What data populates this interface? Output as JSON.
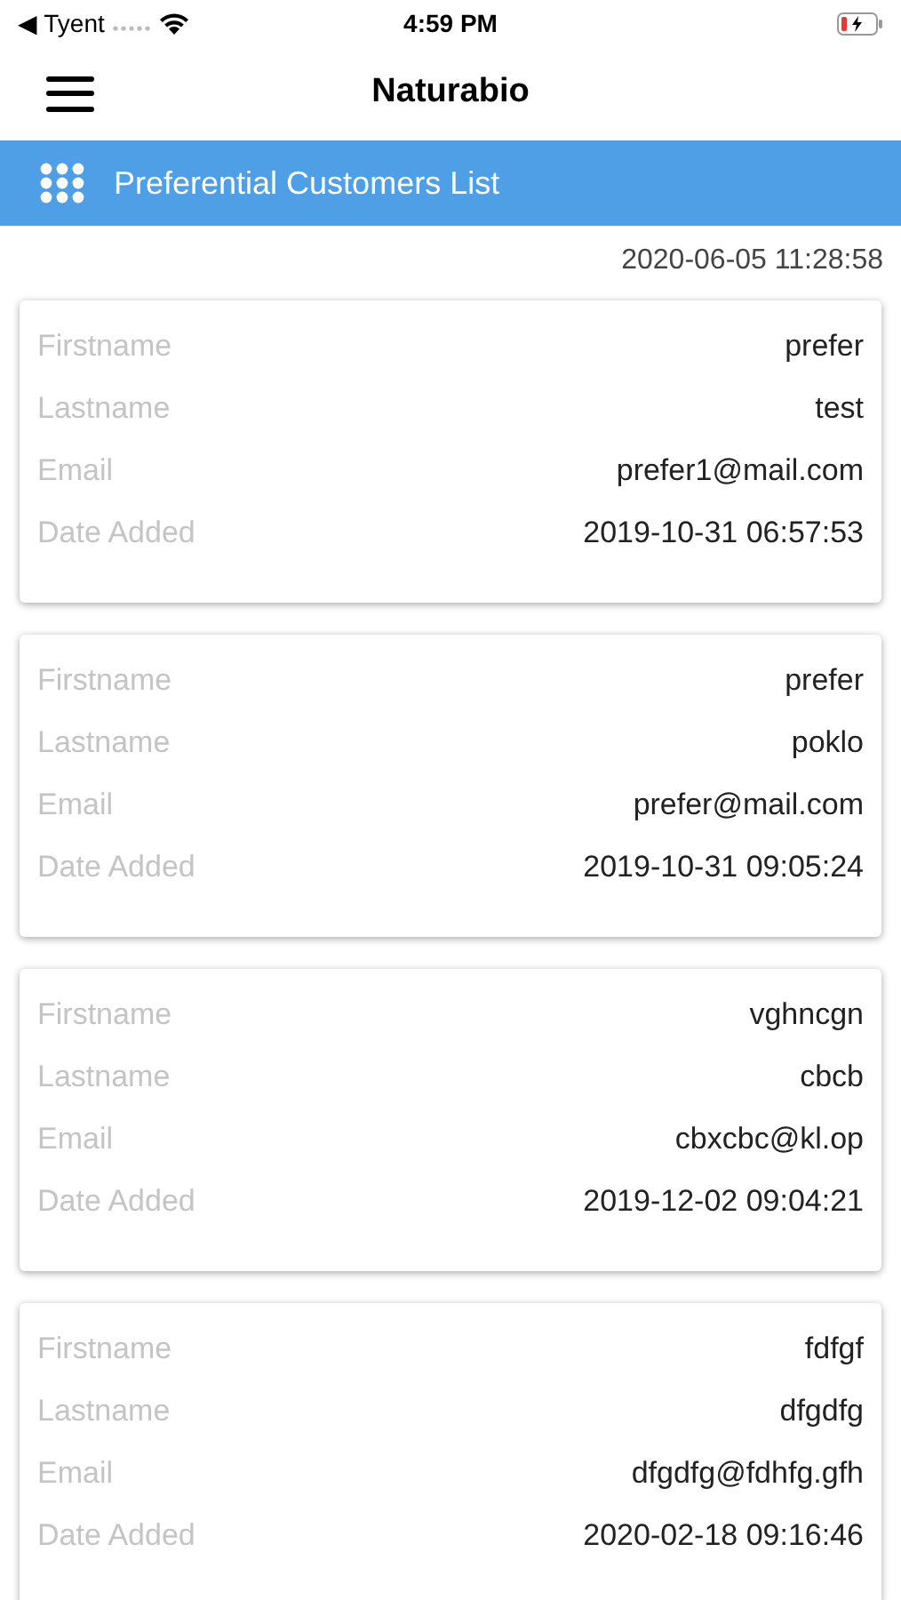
{
  "status_bar": {
    "back_label": "◀ Tyent",
    "time": "4:59 PM"
  },
  "nav": {
    "title": "Naturabio"
  },
  "section": {
    "title": "Preferential Customers List"
  },
  "timestamp": "2020-06-05 11:28:58",
  "customers": [
    {
      "fields": [
        {
          "label": "Firstname",
          "value": "prefer"
        },
        {
          "label": "Lastname",
          "value": "test"
        },
        {
          "label": "Email",
          "value": "prefer1@mail.com"
        },
        {
          "label": "Date Added",
          "value": "2019-10-31 06:57:53"
        }
      ]
    },
    {
      "fields": [
        {
          "label": "Firstname",
          "value": "prefer"
        },
        {
          "label": "Lastname",
          "value": "poklo"
        },
        {
          "label": "Email",
          "value": "prefer@mail.com"
        },
        {
          "label": "Date Added",
          "value": "2019-10-31 09:05:24"
        }
      ]
    },
    {
      "fields": [
        {
          "label": "Firstname",
          "value": "vghncgn"
        },
        {
          "label": "Lastname",
          "value": "cbcb"
        },
        {
          "label": "Email",
          "value": "cbxcbc@kl.op"
        },
        {
          "label": "Date Added",
          "value": "2019-12-02 09:04:21"
        }
      ]
    },
    {
      "fields": [
        {
          "label": "Firstname",
          "value": "fdfgf"
        },
        {
          "label": "Lastname",
          "value": "dfgdfg"
        },
        {
          "label": "Email",
          "value": "dfgdfg@fdhfg.gfh"
        },
        {
          "label": "Date Added",
          "value": "2020-02-18 09:16:46"
        }
      ]
    }
  ]
}
